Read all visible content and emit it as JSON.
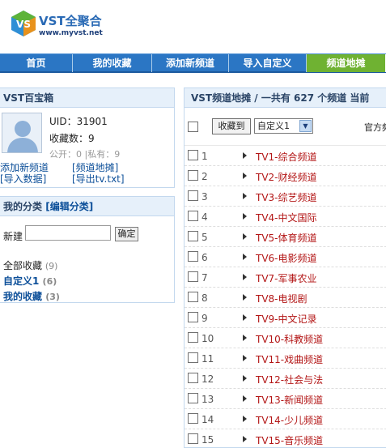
{
  "header": {
    "logo_text": "VST全聚合",
    "url": "www.myvst.net"
  },
  "nav": {
    "items": [
      {
        "label": "首页",
        "active": false
      },
      {
        "label": "我的收藏",
        "active": false
      },
      {
        "label": "添加新频道",
        "active": false
      },
      {
        "label": "导入自定义",
        "active": false
      },
      {
        "label": "频道地摊",
        "active": true
      }
    ]
  },
  "profile": {
    "title": "VST百宝箱",
    "uid_label": "UID：31901",
    "fav_count": "收藏数：9",
    "public_private": "公开：0 |私有：9",
    "links": {
      "add_channel": "添加新频道",
      "channel_map": "[频道地摊]",
      "import_data": "[导入数据]",
      "export_tv": "[导出tv.txt]"
    }
  },
  "categories": {
    "title": "我的分类",
    "edit_label": "[编辑分类]",
    "new_label": "新建",
    "new_value": "",
    "confirm_label": "确定",
    "items": [
      {
        "name": "全部收藏",
        "count": "(9)"
      },
      {
        "name": "自定义1",
        "count": "(6)"
      },
      {
        "name": "我的收藏",
        "count": "(3)"
      }
    ]
  },
  "main": {
    "heading": "VST频道地摊 / 一共有 627 个频道 当前",
    "collect_button": "收藏到",
    "select_value": "自定义1",
    "official_label": "官方频",
    "channels": [
      {
        "num": "1",
        "name": "TV1-综合频道"
      },
      {
        "num": "2",
        "name": "TV2-财经频道"
      },
      {
        "num": "3",
        "name": "TV3-综艺频道"
      },
      {
        "num": "4",
        "name": "TV4-中文国际"
      },
      {
        "num": "5",
        "name": "TV5-体育频道"
      },
      {
        "num": "6",
        "name": "TV6-电影频道"
      },
      {
        "num": "7",
        "name": "TV7-军事农业"
      },
      {
        "num": "8",
        "name": "TV8-电视剧"
      },
      {
        "num": "9",
        "name": "TV9-中文记录"
      },
      {
        "num": "10",
        "name": "TV10-科教频道"
      },
      {
        "num": "11",
        "name": "TV11-戏曲频道"
      },
      {
        "num": "12",
        "name": "TV12-社会与法"
      },
      {
        "num": "13",
        "name": "TV13-新闻频道"
      },
      {
        "num": "14",
        "name": "TV14-少儿频道"
      },
      {
        "num": "15",
        "name": "TV15-音乐频道"
      }
    ]
  },
  "colors": {
    "nav_blue": "#2b76c4",
    "nav_active_green": "#6fb232",
    "channel_red": "#b31616",
    "link_blue": "#0c4f99"
  }
}
